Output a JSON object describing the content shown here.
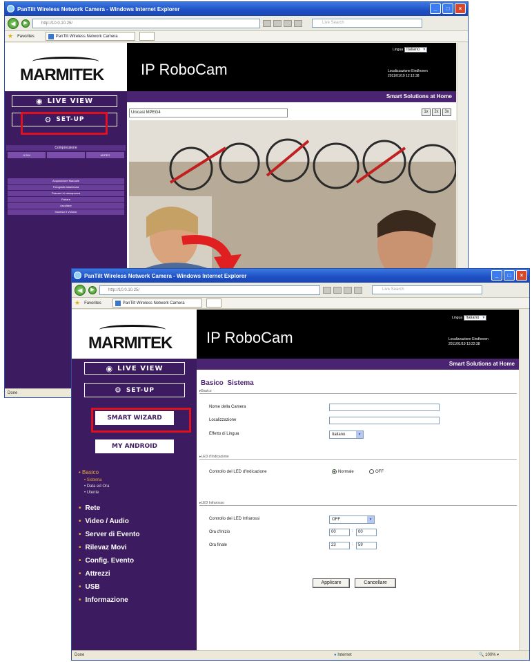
{
  "window_title": "PanTilt Wireless Network Camera - Windows Internet Explorer",
  "address_url": "http://10.0.10.25/",
  "favorites_label": "Favorites",
  "tab_label": "PanTilt Wireless Network Camera",
  "brand": "MARMITEK",
  "app_title": "IP RoboCam",
  "tagline": "Smart Solutions at Home",
  "language_label": "Lingua",
  "language_value": "Italiano",
  "location_label": "Localizzazione Eindhoven",
  "datetime": "2011/01/19 12:12:38",
  "datetime_2": "2011/01/19 13:22:38",
  "live_view_label": "LIVE VIEW",
  "setup_label": "SET-UP",
  "window1": {
    "compression_label": "Compressione",
    "compression_opts": [
      "H.264",
      "",
      "MJPEG"
    ],
    "menu": [
      "Acquisizione Manuale",
      "Fotografia istantanea",
      "Passare in cassapanca",
      "Parlare",
      "Ascoltare",
      "Inserisci il Volume"
    ],
    "camera_name": "Unicast MPEG4",
    "zoom": [
      "1x",
      "2x",
      "3x"
    ],
    "status": "Done"
  },
  "window2": {
    "smart_wizard_label": "SMART WIZARD",
    "my_android_label": "MY ANDROID",
    "nav": {
      "section": "Basico",
      "subs": [
        "Sistema",
        "Data ed Ora",
        "Utente"
      ],
      "main": [
        "Rete",
        "Video / Audio",
        "Server di Evento",
        "Rilevaz Movi",
        "Config. Evento",
        "Attrezzi",
        "USB",
        "Informazione"
      ]
    },
    "breadcrumb": "Basico  Sistema",
    "sec_basico": "Basico",
    "field_camera_name": "Nome della Camera",
    "field_location": "Localizzazione",
    "field_language": "Effetto di Lingua",
    "field_language_value": "Italiano",
    "sec_led_ind": "LED d'Indicazione",
    "field_led_ctrl": "Controllo del LED d'Indicazione",
    "radio_normal": "Normale",
    "radio_off": "OFF",
    "sec_led_ir": "LED Infrarosso",
    "field_ir_ctrl": "Controllo dei LED Infrarossi",
    "field_ir_value": "OFF",
    "field_start": "Ora d'Inizio",
    "start_h": "00",
    "start_m": "00",
    "field_end": "Ora finale",
    "end_h": "23",
    "end_m": "59",
    "apply_label": "Applicare",
    "cancel_label": "Cancellare",
    "status": "Done",
    "zone": "Internet",
    "zoom_level": "100%"
  }
}
